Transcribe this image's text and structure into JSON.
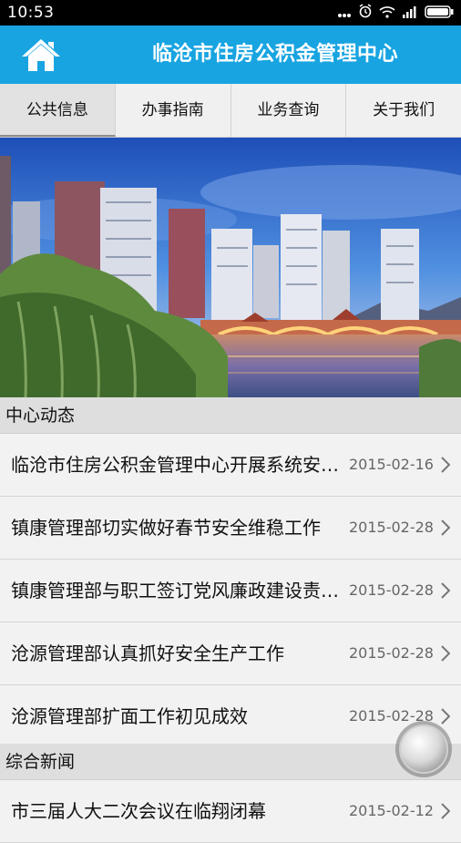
{
  "status_bar": {
    "time": "10:53"
  },
  "header": {
    "title": "临沧市住房公积金管理中心",
    "home_icon": "home-icon",
    "color": "#18a4e1"
  },
  "tabs": [
    {
      "label": "公共信息",
      "active": true
    },
    {
      "label": "办事指南"
    },
    {
      "label": "业务查询"
    },
    {
      "label": "关于我们"
    }
  ],
  "sections": [
    {
      "title": "中心动态",
      "items": [
        {
          "title": "临沧市住房公积金管理中心开展系统安全检查工作",
          "date": "2015-02-16"
        },
        {
          "title": "镇康管理部切实做好春节安全维稳工作",
          "date": "2015-02-28"
        },
        {
          "title": "镇康管理部与职工签订党风廉政建设责任书",
          "date": "2015-02-28"
        },
        {
          "title": "沧源管理部认真抓好安全生产工作",
          "date": "2015-02-28"
        },
        {
          "title": "沧源管理部扩面工作初见成效",
          "date": "2015-02-28"
        }
      ]
    },
    {
      "title": "综合新闻",
      "items": [
        {
          "title": "市三届人大二次会议在临翔闭幕",
          "date": "2015-02-12"
        }
      ]
    }
  ]
}
